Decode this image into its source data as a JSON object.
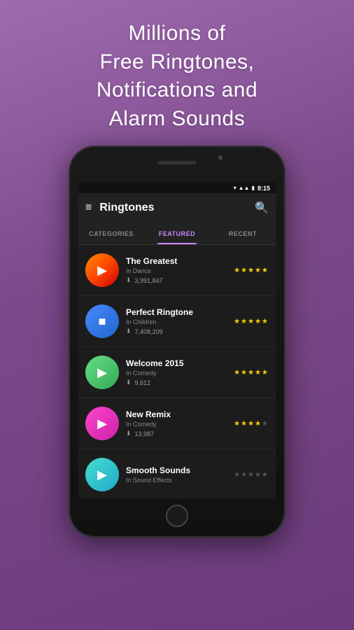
{
  "hero": {
    "line1": "Millions of",
    "line2": "Free Ringtones,",
    "line3": "Notifications and",
    "line4": "Alarm Sounds"
  },
  "status_bar": {
    "time": "8:15"
  },
  "app_bar": {
    "title": "Ringtones"
  },
  "tabs": [
    {
      "label": "CATEGORIES",
      "active": false
    },
    {
      "label": "FEATURED",
      "active": true
    },
    {
      "label": "RECENT",
      "active": false
    }
  ],
  "songs": [
    {
      "title": "The Greatest",
      "category": "In Dance",
      "downloads": "3,991,847",
      "stars": 5,
      "thumb_class": "thumb-dance",
      "icon": "▶"
    },
    {
      "title": "Perfect Ringtone",
      "category": "In Children",
      "downloads": "7,408,209",
      "stars": 5,
      "thumb_class": "thumb-children",
      "icon": "■"
    },
    {
      "title": "Welcome 2015",
      "category": "In Comedy",
      "downloads": "9,612",
      "stars": 5,
      "thumb_class": "thumb-comedy",
      "icon": "▶"
    },
    {
      "title": "New Remix",
      "category": "In Comedy",
      "downloads": "13,987",
      "stars": 4,
      "thumb_class": "thumb-remix",
      "icon": "▶"
    },
    {
      "title": "Smooth Sounds",
      "category": "In Sound Effects",
      "downloads": "",
      "stars": 0,
      "thumb_class": "thumb-smooth",
      "icon": "▶"
    }
  ],
  "colors": {
    "accent": "#cc88ff",
    "star": "#ffcc00",
    "bg": "#7b4a8a"
  }
}
